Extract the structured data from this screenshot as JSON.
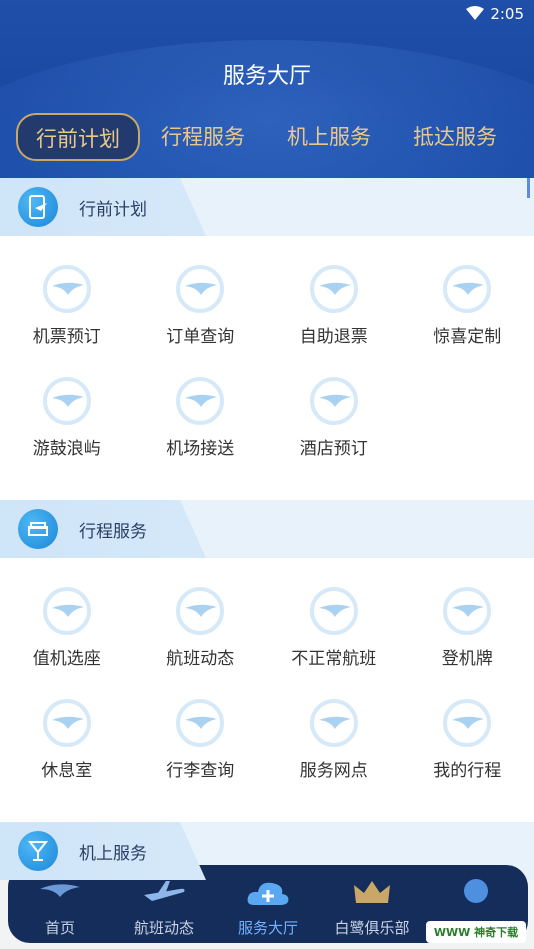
{
  "status_bar": {
    "time": "2:05"
  },
  "header": {
    "title": "服务大厅",
    "tabs": [
      {
        "label": "行前计划",
        "active": true
      },
      {
        "label": "行程服务",
        "active": false
      },
      {
        "label": "机上服务",
        "active": false
      },
      {
        "label": "抵达服务",
        "active": false
      }
    ]
  },
  "sections": [
    {
      "title": "行前计划",
      "icon": "phone-plane-icon",
      "items": [
        "机票预订",
        "订单查询",
        "自助退票",
        "惊喜定制",
        "游鼓浪屿",
        "机场接送",
        "酒店预订"
      ]
    },
    {
      "title": "行程服务",
      "icon": "sofa-icon",
      "items": [
        "值机选座",
        "航班动态",
        "不正常航班",
        "登机牌",
        "休息室",
        "行李查询",
        "服务网点",
        "我的行程"
      ]
    },
    {
      "title": "机上服务",
      "icon": "cocktail-icon",
      "items": []
    }
  ],
  "bottom_nav": [
    {
      "label": "首页",
      "icon": "egret-logo-icon",
      "active": false
    },
    {
      "label": "航班动态",
      "icon": "airplane-icon",
      "active": false
    },
    {
      "label": "服务大厅",
      "icon": "cloud-plus-icon",
      "active": true
    },
    {
      "label": "白鹭俱乐部",
      "icon": "crown-icon",
      "active": false
    },
    {
      "label": "",
      "icon": "profile-icon",
      "active": false
    }
  ],
  "watermark": "WWW 神奇下载",
  "colors": {
    "header_bg": "#1b4aa5",
    "tab_gold": "#e9c98a",
    "nav_bg": "#152d5a",
    "accent": "#1b86d8"
  }
}
